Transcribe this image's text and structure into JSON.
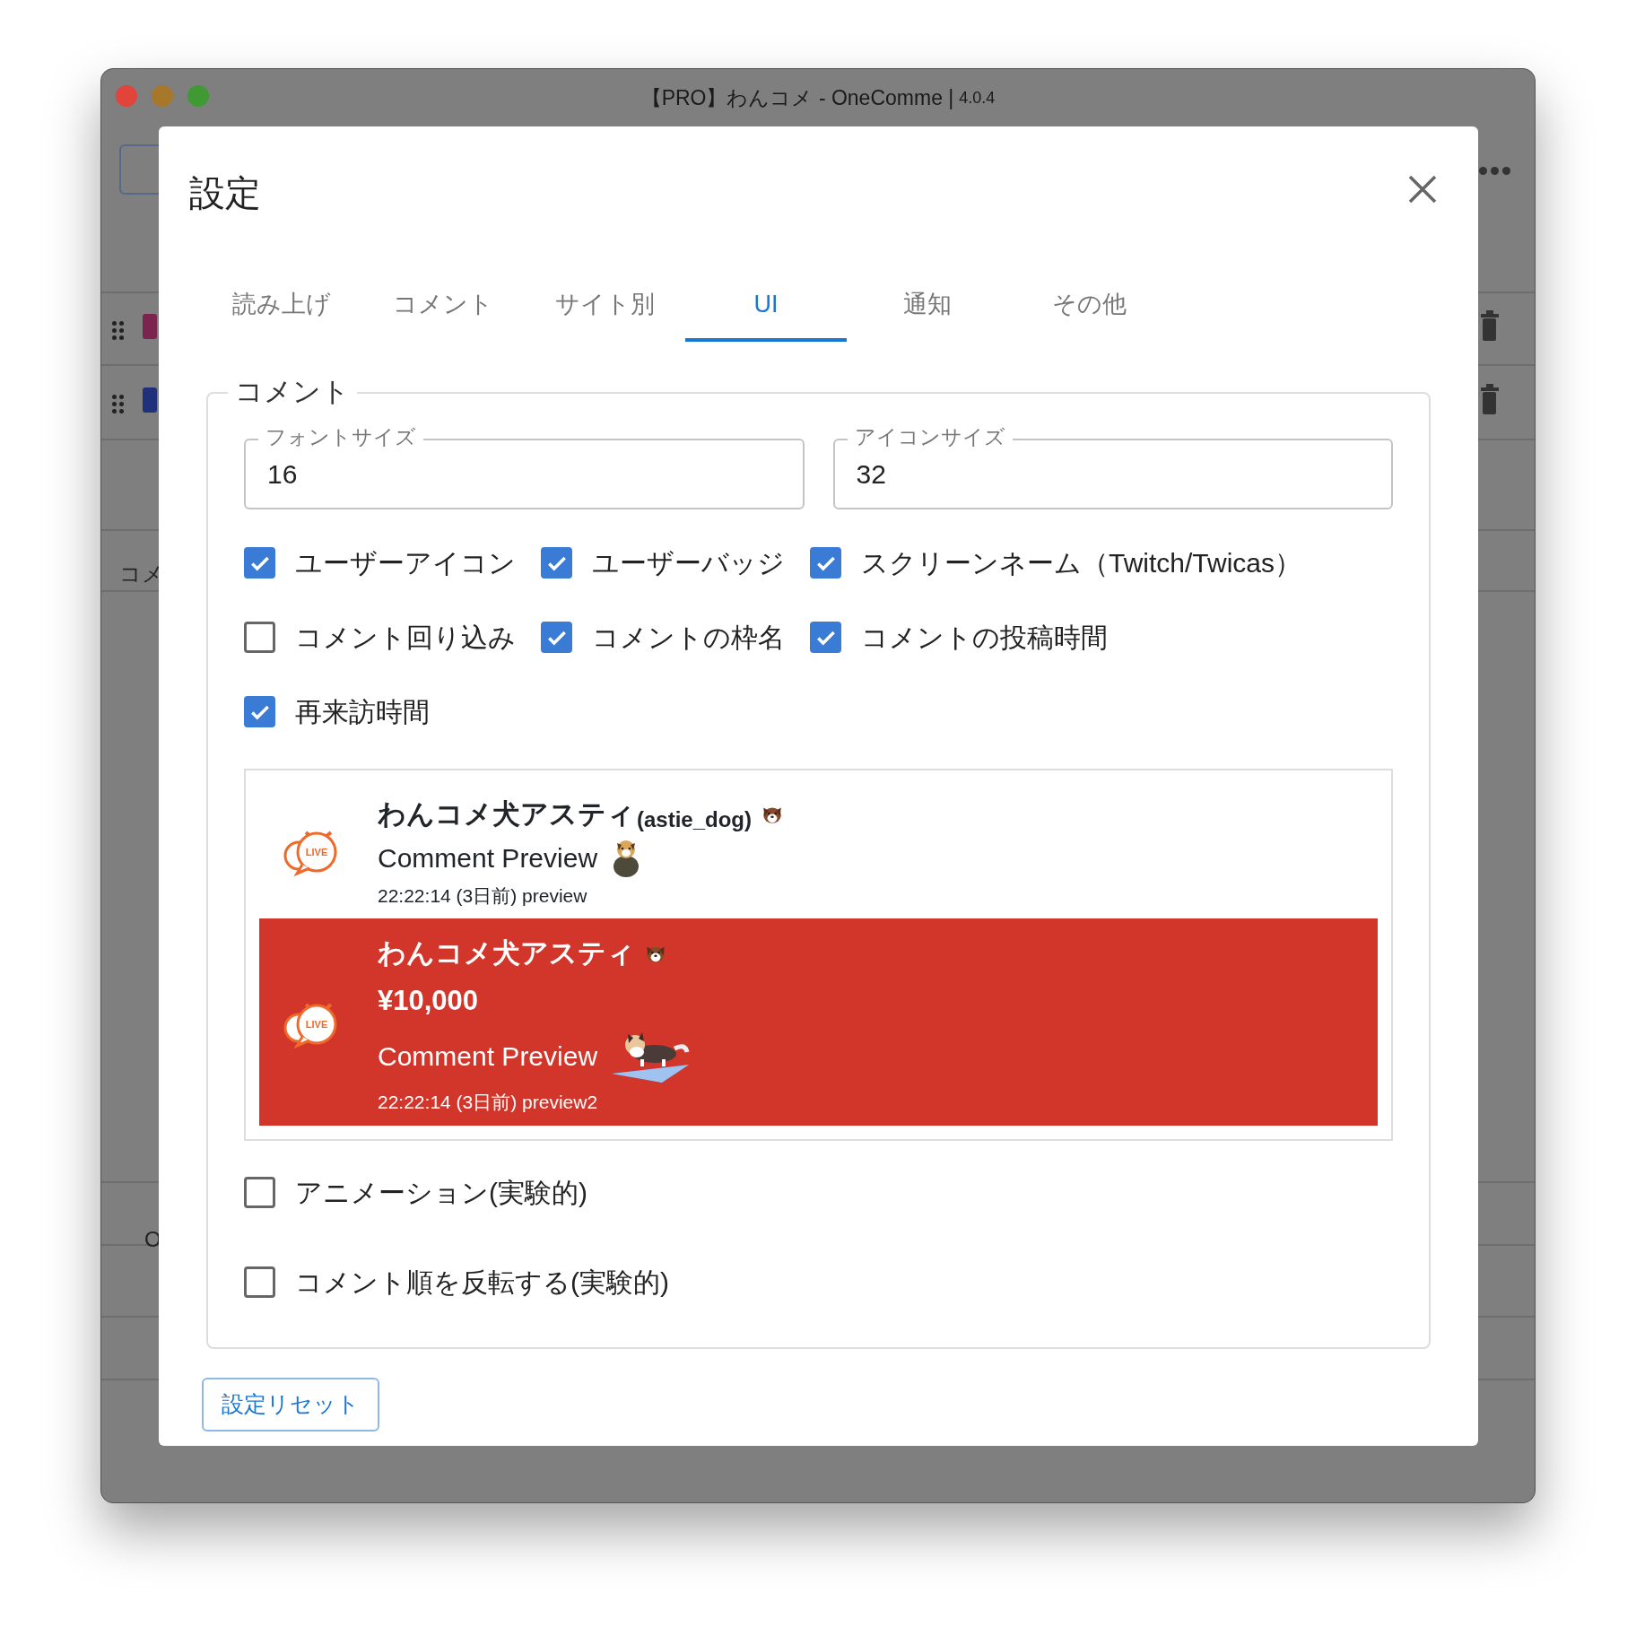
{
  "window": {
    "title": "【PRO】わんコメ - OneComme |",
    "version": "4.0.4"
  },
  "background": {
    "rows": [
      {
        "color": "#7c2450"
      },
      {
        "color": "#21307a"
      }
    ],
    "labels": [
      "コメ",
      "O"
    ]
  },
  "dialog": {
    "title": "設定",
    "tabs": [
      {
        "label": "読み上げ",
        "selected": false
      },
      {
        "label": "コメント",
        "selected": false
      },
      {
        "label": "サイト別",
        "selected": false
      },
      {
        "label": "UI",
        "selected": true
      },
      {
        "label": "通知",
        "selected": false
      },
      {
        "label": "その他",
        "selected": false
      }
    ],
    "section": {
      "legend": "コメント",
      "fields": [
        {
          "label": "フォントサイズ",
          "value": "16"
        },
        {
          "label": "アイコンサイズ",
          "value": "32"
        }
      ],
      "checkbox_rows": [
        [
          {
            "label": "ユーザーアイコン",
            "checked": true
          },
          {
            "label": "ユーザーバッジ",
            "checked": true
          },
          {
            "label": "スクリーンネーム（Twitch/Twicas）",
            "checked": true
          }
        ],
        [
          {
            "label": "コメント回り込み",
            "checked": false
          },
          {
            "label": "コメントの枠名",
            "checked": true
          },
          {
            "label": "コメントの投稿時間",
            "checked": true
          }
        ],
        [
          {
            "label": "再来訪時間",
            "checked": true
          }
        ]
      ],
      "preview": [
        {
          "kind": "normal",
          "live_label": "LIVE",
          "name": "わんコメ犬アスティ",
          "screen_name": "(astie_dog)",
          "text": "Comment Preview",
          "time": "22:22:14 (3日前) preview"
        },
        {
          "kind": "paid",
          "live_label": "LIVE",
          "name": "わんコメ犬アスティ",
          "amount": "¥10,000",
          "text": "Comment Preview",
          "time": "22:22:14 (3日前) preview2"
        }
      ],
      "options": [
        {
          "label": "アニメーション(実験的)",
          "checked": false
        },
        {
          "label": "コメント順を反転する(実験的)",
          "checked": false
        }
      ]
    },
    "reset_button": "設定リセット"
  }
}
